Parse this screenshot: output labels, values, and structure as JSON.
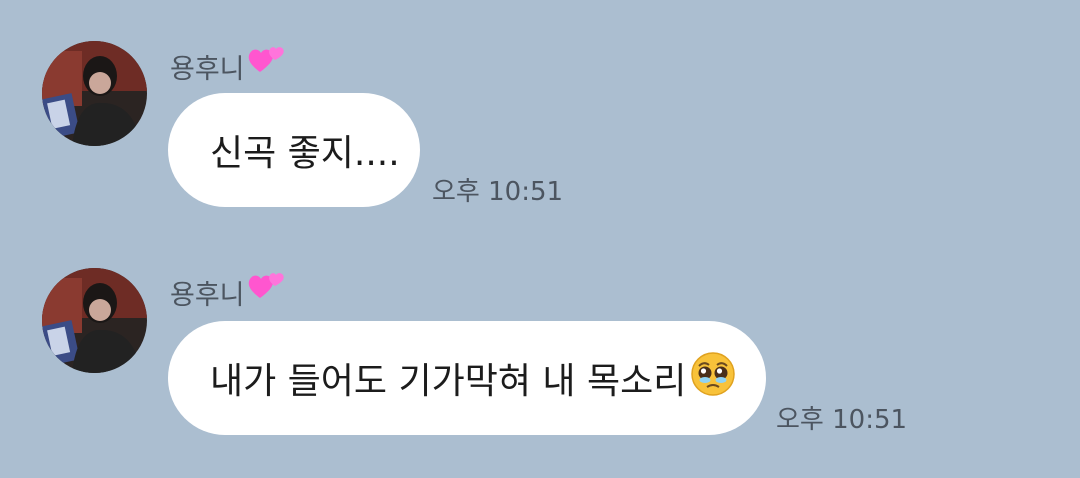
{
  "conversation": {
    "messages": [
      {
        "sender": "용후니",
        "sender_emoji": "two-hearts-icon",
        "text": "신곡 좋지....",
        "time": "오후 10:51"
      },
      {
        "sender": "용후니",
        "sender_emoji": "two-hearts-icon",
        "text": "내가 들어도 기가막혀 내 목소리",
        "text_emoji": "pleading-face-icon",
        "time": "오후 10:51"
      }
    ]
  },
  "colors": {
    "background": "#abbed0",
    "bubble": "#ffffff",
    "meta_text": "#4c5560",
    "heart": "#ff5fd2"
  }
}
